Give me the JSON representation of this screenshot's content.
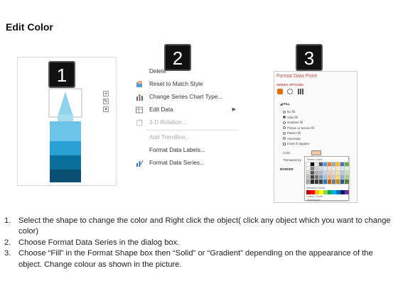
{
  "title": "Edit Color",
  "steps_badges": [
    "1",
    "2",
    "3"
  ],
  "menu": {
    "items": [
      {
        "label": "Delete",
        "icon": "none",
        "disabled": false,
        "submenu": false
      },
      {
        "label": "Reset to Match Style",
        "icon": "reset-style-icon",
        "disabled": false,
        "submenu": false
      },
      {
        "label": "Change Series Chart Type...",
        "icon": "chart-type-icon",
        "disabled": false,
        "submenu": false
      },
      {
        "label": "Edit Data",
        "icon": "edit-data-icon",
        "disabled": false,
        "submenu": true
      },
      {
        "label": "3-D Rotation...",
        "icon": "rotation-icon",
        "disabled": true,
        "submenu": false
      },
      {
        "label": "Add Trendline...",
        "icon": "none",
        "disabled": true,
        "submenu": false
      },
      {
        "label": "Format Data Labels...",
        "icon": "none",
        "disabled": false,
        "submenu": false
      },
      {
        "label": "Format Data Series...",
        "icon": "format-series-icon",
        "disabled": false,
        "submenu": false
      }
    ]
  },
  "format_pane": {
    "title": "Format Data Point",
    "subtitle": "SERIES OPTIONS",
    "fill_header": "FILL",
    "options": [
      "No fill",
      "Solid fill",
      "Gradient fill",
      "Picture or texture fill",
      "Pattern fill",
      "Automatic",
      "Invert if negative"
    ],
    "selected_option": "Solid fill",
    "color_label": "Color",
    "transparency_label": "Transparency",
    "border_label": "BORDER",
    "popup": {
      "theme_label": "Theme Colors",
      "standard_label": "Standard Colors",
      "more_colors": "More Colors...",
      "eyedropper": "Eyedropper"
    }
  },
  "instructions": [
    {
      "num": "1.",
      "text": "Select the shape to change the color and Right click the object( click any object which you want to change color)"
    },
    {
      "num": "2.",
      "text": "Choose Format Data Series in the dialog box."
    },
    {
      "num": "3.",
      "text": "Choose “Fill” in the Format Shape box then “Solid” or “Gradient” depending on the appearance of the object. Change colour as shown in the picture."
    }
  ],
  "colors": {
    "tower_light": "#8fd3ec",
    "tower_mid": "#2aa0d4",
    "tower_dark": "#0b6f9c",
    "tower_darkest": "#0a4f73",
    "accent": "#c0504d"
  }
}
